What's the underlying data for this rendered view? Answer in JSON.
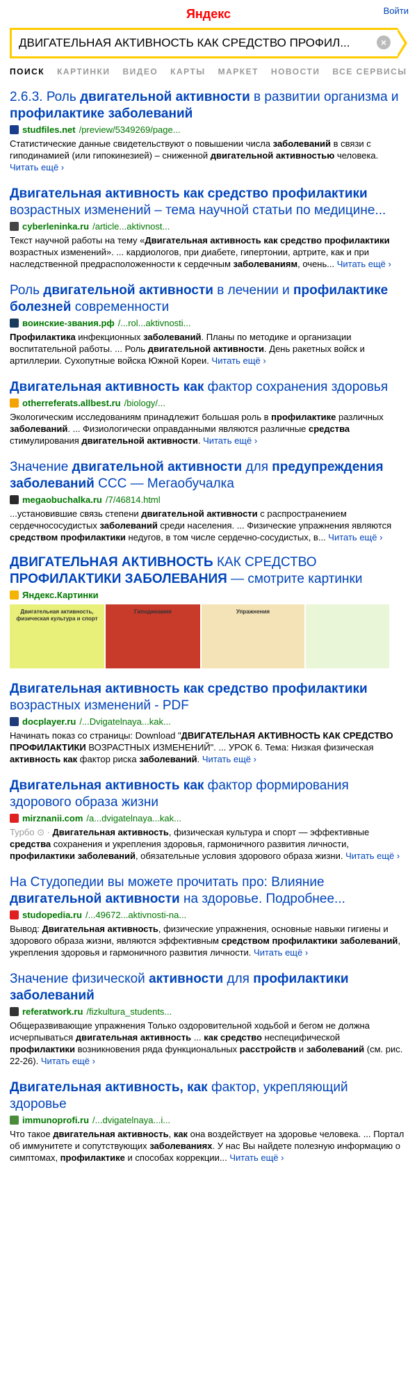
{
  "header": {
    "logo": "Яндекс",
    "login": "Войти"
  },
  "search": {
    "value": "ДВИГАТЕЛЬНАЯ АКТИВНОСТЬ КАК СРЕДСТВО ПРОФИЛ..."
  },
  "tabs": [
    "ПОИСК",
    "КАРТИНКИ",
    "ВИДЕО",
    "КАРТЫ",
    "МАРКЕТ",
    "НОВОСТИ",
    "ВСЕ СЕРВИСЫ"
  ],
  "results": [
    {
      "title": [
        [
          "2.6.3. Роль ",
          false
        ],
        [
          "двигательной активности",
          true
        ],
        [
          " в развитии организма и ",
          false
        ],
        [
          "профилактике заболеваний",
          true
        ]
      ],
      "favicon_color": "#1a3c8c",
      "favicon_icon": "s-icon",
      "domain": "studfiles.net",
      "path": "/preview/5349269/page...",
      "snippet": [
        [
          "Статистические данные свидетельствуют о повышении числа ",
          false
        ],
        [
          "заболеваний",
          true
        ],
        [
          " в связи с гиподинамией (или гипокинезией) – сниженной ",
          false
        ],
        [
          "двигательной активностью",
          true
        ],
        [
          " человека. ",
          false
        ]
      ],
      "more": "Читать ещё ›"
    },
    {
      "title": [
        [
          "Двигательная активность как средство профилактики",
          true
        ],
        [
          " возрастных изменений – тема научной статьи по медицине...",
          false
        ]
      ],
      "favicon_color": "#444444",
      "favicon_icon": "cyberleninka-icon",
      "domain": "cyberleninka.ru",
      "path": "/article...aktivnost...",
      "snippet": [
        [
          "Текст научной работы на тему «",
          false
        ],
        [
          "Двигательная активность как средство профилактики",
          true
        ],
        [
          " возрастных изменений». ... кардиологов, при диабете, гипертонии, артрите, как и при наследственной предрасположенности к сердечным ",
          false
        ],
        [
          "заболеваниям",
          true
        ],
        [
          ", очень... ",
          false
        ]
      ],
      "more": "Читать ещё ›"
    },
    {
      "title": [
        [
          "Роль ",
          false
        ],
        [
          "двигательной активности",
          true
        ],
        [
          " в лечении и ",
          false
        ],
        [
          "профилактике болезней",
          true
        ],
        [
          " современности",
          false
        ]
      ],
      "favicon_color": "#1a3c5c",
      "favicon_icon": "knight-icon",
      "domain": "воинские-звания.рф",
      "path": "/...rol...aktivnosti...",
      "snippet": [
        [
          "Профилактика",
          true
        ],
        [
          " инфекционных ",
          false
        ],
        [
          "заболеваний",
          true
        ],
        [
          ". Планы по методике и организации воспитательной работы. ... Роль ",
          false
        ],
        [
          "двигательной активности",
          true
        ],
        [
          ". День ракетных войск и артиллерии. Сухопутные войска Южной Кореи. ",
          false
        ]
      ],
      "more": "Читать ещё ›"
    },
    {
      "title": [
        [
          "Двигательная активность как",
          true
        ],
        [
          " фактор сохранения здоровья",
          false
        ]
      ],
      "favicon_color": "#f5a300",
      "favicon_icon": "thumbs-up-icon",
      "domain": "otherreferats.allbest.ru",
      "path": "/biology/...",
      "snippet": [
        [
          "Экологическим исследованиям принадлежит большая роль в ",
          false
        ],
        [
          "профилактике",
          true
        ],
        [
          " различных ",
          false
        ],
        [
          "заболеваний",
          true
        ],
        [
          ". ... Физиологически оправданными являются различные ",
          false
        ],
        [
          "средства",
          true
        ],
        [
          " стимулирования ",
          false
        ],
        [
          "двигательной активности",
          true
        ],
        [
          ". ",
          false
        ]
      ],
      "more": "Читать ещё ›"
    },
    {
      "title": [
        [
          "Значение ",
          false
        ],
        [
          "двигательной активности",
          true
        ],
        [
          " для ",
          false
        ],
        [
          "предупреждения заболеваний",
          true
        ],
        [
          " ССС — Мегаобучалка",
          false
        ]
      ],
      "favicon_color": "#2a2a2a",
      "favicon_icon": "megaobuchalka-icon",
      "domain": "megaobuchalka.ru",
      "path": "/7/46814.html",
      "snippet": [
        [
          "...установившие связь степени ",
          false
        ],
        [
          "двигательной активности",
          true
        ],
        [
          " с распространением сердечнососудистых ",
          false
        ],
        [
          "заболеваний",
          true
        ],
        [
          " среди населения. ... Физические упражнения являются ",
          false
        ],
        [
          "средством профилактики",
          true
        ],
        [
          " недугов, в том числе сердечно-сосудистых, в... ",
          false
        ]
      ],
      "more": "Читать ещё ›"
    }
  ],
  "images": {
    "title": [
      [
        "ДВИГАТЕЛЬНАЯ АКТИВНОСТЬ",
        true
      ],
      [
        " КАК СРЕДСТВО ",
        false
      ],
      [
        "ПРОФИЛАКТИКИ ЗАБОЛЕВАНИЯ",
        true
      ],
      [
        " — смотрите картинки",
        false
      ]
    ],
    "source": "Яндекс.Картинки",
    "thumbs": [
      {
        "label": "Двигательная активность, физическая культура и спорт",
        "color": "#e8f07a"
      },
      {
        "label": "Гиподинамия",
        "color": "#c83a2a"
      },
      {
        "label": "Упражнения",
        "color": "#f4e3b6"
      },
      {
        "label": "",
        "color": "#e9f7d8"
      }
    ]
  },
  "results2": [
    {
      "title": [
        [
          "Двигательная активность как средство профилактики",
          true
        ],
        [
          " возрастных изменений - PDF",
          false
        ]
      ],
      "favicon_color": "#1f3a7a",
      "favicon_icon": "d-icon",
      "domain": "docplayer.ru",
      "path": "/...Dvigatelnaya...kak...",
      "snippet": [
        [
          "Начинать показ со страницы: Download \"",
          false
        ],
        [
          "ДВИГАТЕЛЬНАЯ АКТИВНОСТЬ КАК СРЕДСТВО ПРОФИЛАКТИКИ",
          true
        ],
        [
          " ВОЗРАСТНЫХ ИЗМЕНЕНИЙ\". ... УРОК 6. Тема: Низкая физическая ",
          false
        ],
        [
          "активность как",
          true
        ],
        [
          " фактор риска ",
          false
        ],
        [
          "заболеваний",
          true
        ],
        [
          ". ",
          false
        ]
      ],
      "more": "Читать ещё ›"
    },
    {
      "title": [
        [
          "Двигательная активность как",
          true
        ],
        [
          " фактор формирования здорового образа жизни",
          false
        ]
      ],
      "favicon_color": "#e02020",
      "favicon_icon": "checkmark-icon",
      "domain": "mirznanii.com",
      "path": "/a...dvigatelnaya...kak...",
      "turbo": "Турбо",
      "snippet": [
        [
          "Двигательная активность",
          true
        ],
        [
          ", физическая культура и спорт — эффективные ",
          false
        ],
        [
          "средства",
          true
        ],
        [
          " сохранения и укрепления здоровья, гармоничного развития личности, ",
          false
        ],
        [
          "профилактики заболеваний",
          true
        ],
        [
          ", обязательные условия здорового образа жизни. ",
          false
        ]
      ],
      "more": "Читать ещё ›"
    },
    {
      "title": [
        [
          "На Студопедии вы можете прочитать про: Влияние ",
          false
        ],
        [
          "двигательной активности",
          true
        ],
        [
          " на здоровье. Подробнее...",
          false
        ]
      ],
      "favicon_color": "#e02020",
      "favicon_icon": "s-red-icon",
      "domain": "studopedia.ru",
      "path": "/...49672...aktivnosti-na...",
      "snippet": [
        [
          "Вывод: ",
          false
        ],
        [
          "Двигательная активность",
          true
        ],
        [
          ", физические упражнения, основные навыки гигиены и здорового образа жизни, являются эффективным ",
          false
        ],
        [
          "средством профилактики заболеваний",
          true
        ],
        [
          ", укрепления здоровья и гармоничного развития личности. ",
          false
        ]
      ],
      "more": "Читать ещё ›"
    },
    {
      "title": [
        [
          "Значение физической ",
          false
        ],
        [
          "активности",
          true
        ],
        [
          " для ",
          false
        ],
        [
          "профилактики заболеваний",
          true
        ]
      ],
      "favicon_color": "#333333",
      "favicon_icon": "books-icon",
      "domain": "referatwork.ru",
      "path": "/fizkultura_students...",
      "snippet": [
        [
          "Общеразвивающие упражнения Только оздоровительной ходьбой и бегом не должна исчерпываться ",
          false
        ],
        [
          "двигательная активность",
          true
        ],
        [
          " ... ",
          false
        ],
        [
          "как средство",
          true
        ],
        [
          " неспецифической ",
          false
        ],
        [
          "профилактики",
          true
        ],
        [
          " возникновения ряда функциональных ",
          false
        ],
        [
          "расстройств",
          true
        ],
        [
          " и ",
          false
        ],
        [
          "заболеваний",
          true
        ],
        [
          " (см. рис. 22-26). ",
          false
        ]
      ],
      "more": "Читать ещё ›"
    },
    {
      "title": [
        [
          "Двигательная активность, как",
          true
        ],
        [
          " фактор, укрепляющий здоровье",
          false
        ]
      ],
      "favicon_color": "#4a8c3a",
      "favicon_icon": "leaf-icon",
      "domain": "immunoprofi.ru",
      "path": "/...dvigatelnaya...i...",
      "snippet": [
        [
          "Что такое ",
          false
        ],
        [
          "двигательная активность",
          true
        ],
        [
          ", ",
          false
        ],
        [
          "как",
          true
        ],
        [
          " она воздействует на здоровье человека. ... Портал об иммунитете и сопутствующих ",
          false
        ],
        [
          "заболеваниях",
          true
        ],
        [
          ". У нас Вы найдете полезную информацию о симптомах, ",
          false
        ],
        [
          "профилактике",
          true
        ],
        [
          " и способах коррекции... ",
          false
        ]
      ],
      "more": "Читать ещё ›"
    }
  ]
}
